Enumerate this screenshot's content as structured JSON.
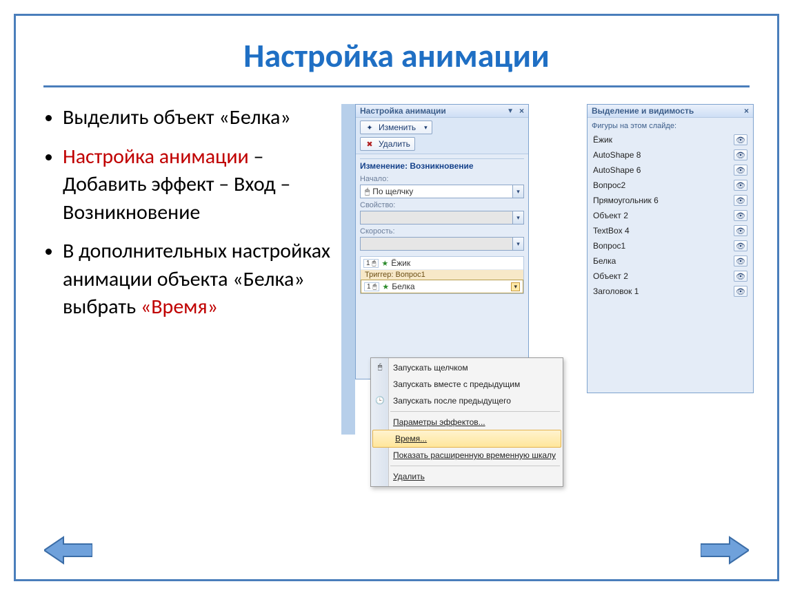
{
  "title": "Настройка анимации",
  "bullets": {
    "b1": "Выделить объект «Белка»",
    "b2a": "Настройка анимации",
    "b2b": " – Добавить эффект – Вход – Возникновение",
    "b3a": "В дополнительных настройках анимации объекта «Белка» выбрать ",
    "b3b": "«Время»"
  },
  "anim_pane": {
    "header": "Настройка анимации",
    "btn_change": "Изменить",
    "btn_delete": "Удалить",
    "section_change": "Изменение: Возникновение",
    "lbl_start": "Начало:",
    "val_start": "По щелчку",
    "lbl_property": "Свойство:",
    "lbl_speed": "Скорость:",
    "row1": "Ёжик",
    "trigger": "Триггер: Вопрос1",
    "row2": "Белка"
  },
  "ctx": {
    "m1": "Запускать щелчком",
    "m2": "Запускать вместе с предыдущим",
    "m3": "Запускать после предыдущего",
    "m4": "Параметры эффектов...",
    "m5": "Время...",
    "m6": "Показать расширенную временную шкалу",
    "m7": "Удалить"
  },
  "vis_pane": {
    "header": "Выделение и видимость",
    "sub": "Фигуры на этом слайде:",
    "items": [
      "Ёжик",
      "AutoShape 8",
      "AutoShape 6",
      "Вопрос2",
      "Прямоугольник 6",
      "Объект 2",
      "TextBox 4",
      "Вопрос1",
      "Белка",
      "Объект 2",
      "Заголовок 1"
    ]
  }
}
